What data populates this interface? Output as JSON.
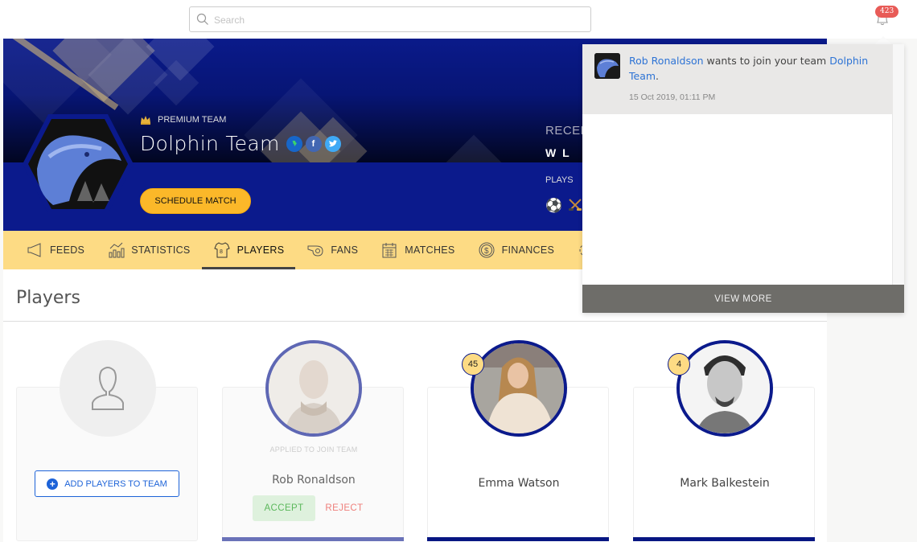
{
  "topbar": {
    "search_placeholder": "Search",
    "notification_count": "423"
  },
  "team": {
    "premium_label": "PREMIUM TEAM",
    "name": "Dolphin Team",
    "schedule_button": "SCHEDULE MATCH",
    "recent_label": "RECENT",
    "recent_results": "W L",
    "plays_label": "PLAYS",
    "sports": [
      "soccer-ball",
      "hockey-sticks"
    ],
    "links": [
      "website-globe",
      "facebook",
      "twitter"
    ]
  },
  "tabs": [
    {
      "label": "FEEDS",
      "icon": "megaphone-icon",
      "active": false
    },
    {
      "label": "STATISTICS",
      "icon": "statistics-icon",
      "active": false
    },
    {
      "label": "PLAYERS",
      "icon": "jersey-icon",
      "active": true
    },
    {
      "label": "FANS",
      "icon": "whistle-icon",
      "active": false
    },
    {
      "label": "MATCHES",
      "icon": "calendar-icon",
      "active": false
    },
    {
      "label": "FINANCES",
      "icon": "dollar-coin-icon",
      "active": false
    },
    {
      "label": "",
      "icon": "settings-gear-icon",
      "active": false
    }
  ],
  "players_section": {
    "title": "Players",
    "add_button": "ADD PLAYERS TO TEAM",
    "players": [
      {
        "name": "Rob Ronaldson",
        "status": "APPLIED TO JOIN TEAM",
        "accept": "ACCEPT",
        "reject": "REJECT",
        "number": null
      },
      {
        "name": "Emma Watson",
        "number": "45"
      },
      {
        "name": "Mark Balkestein",
        "number": "4"
      }
    ]
  },
  "notifications": {
    "items": [
      {
        "user": "Rob Ronaldson",
        "text": " wants to join your team ",
        "team": "Dolphin Team",
        "suffix": ".",
        "time": "15 Oct 2019, 01:11 PM"
      }
    ],
    "view_more": "VIEW MORE"
  },
  "colors": {
    "brand_blue": "#0b1a8c",
    "accent_yellow": "#fbb829",
    "tab_bar": "#fddb84",
    "link_blue": "#2d73d5",
    "badge_red": "#e85b57"
  }
}
